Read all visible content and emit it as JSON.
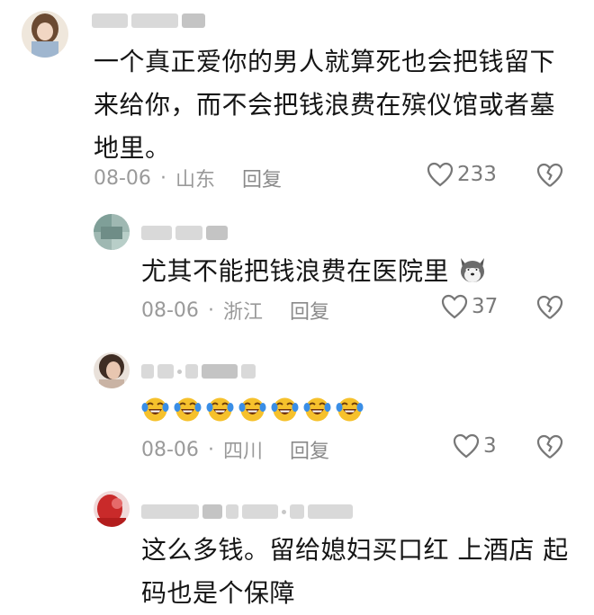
{
  "comments": [
    {
      "text_line1": "一个真正爱你的男人就算死也会把钱留下",
      "text_line2": "来给你，而不会把钱浪费在殡仪馆或者墓",
      "text_line3": "地里。",
      "date": "08-06",
      "location": "山东",
      "reply_label": "回复",
      "likes": "233"
    },
    {
      "text": "尤其不能把钱浪费在医院里",
      "date": "08-06",
      "location": "浙江",
      "reply_label": "回复",
      "likes": "37",
      "emoji": "husky-emoji"
    },
    {
      "emoji": "laughing-tears-emoji",
      "emoji_count": 7,
      "date": "08-06",
      "location": "四川",
      "reply_label": "回复",
      "likes": "3"
    },
    {
      "text_line1": "这么多钱。留给媳妇买口红 上酒店 起",
      "text_line2": "码也是个保障"
    }
  ],
  "separator": "·",
  "icons": {
    "like": "heart-outline-icon",
    "dislike": "broken-heart-icon"
  },
  "colors": {
    "text": "#151515",
    "meta": "#9a9a9a",
    "emoji_yellow": "#f6c12c",
    "emoji_blue": "#3a8ee6"
  }
}
